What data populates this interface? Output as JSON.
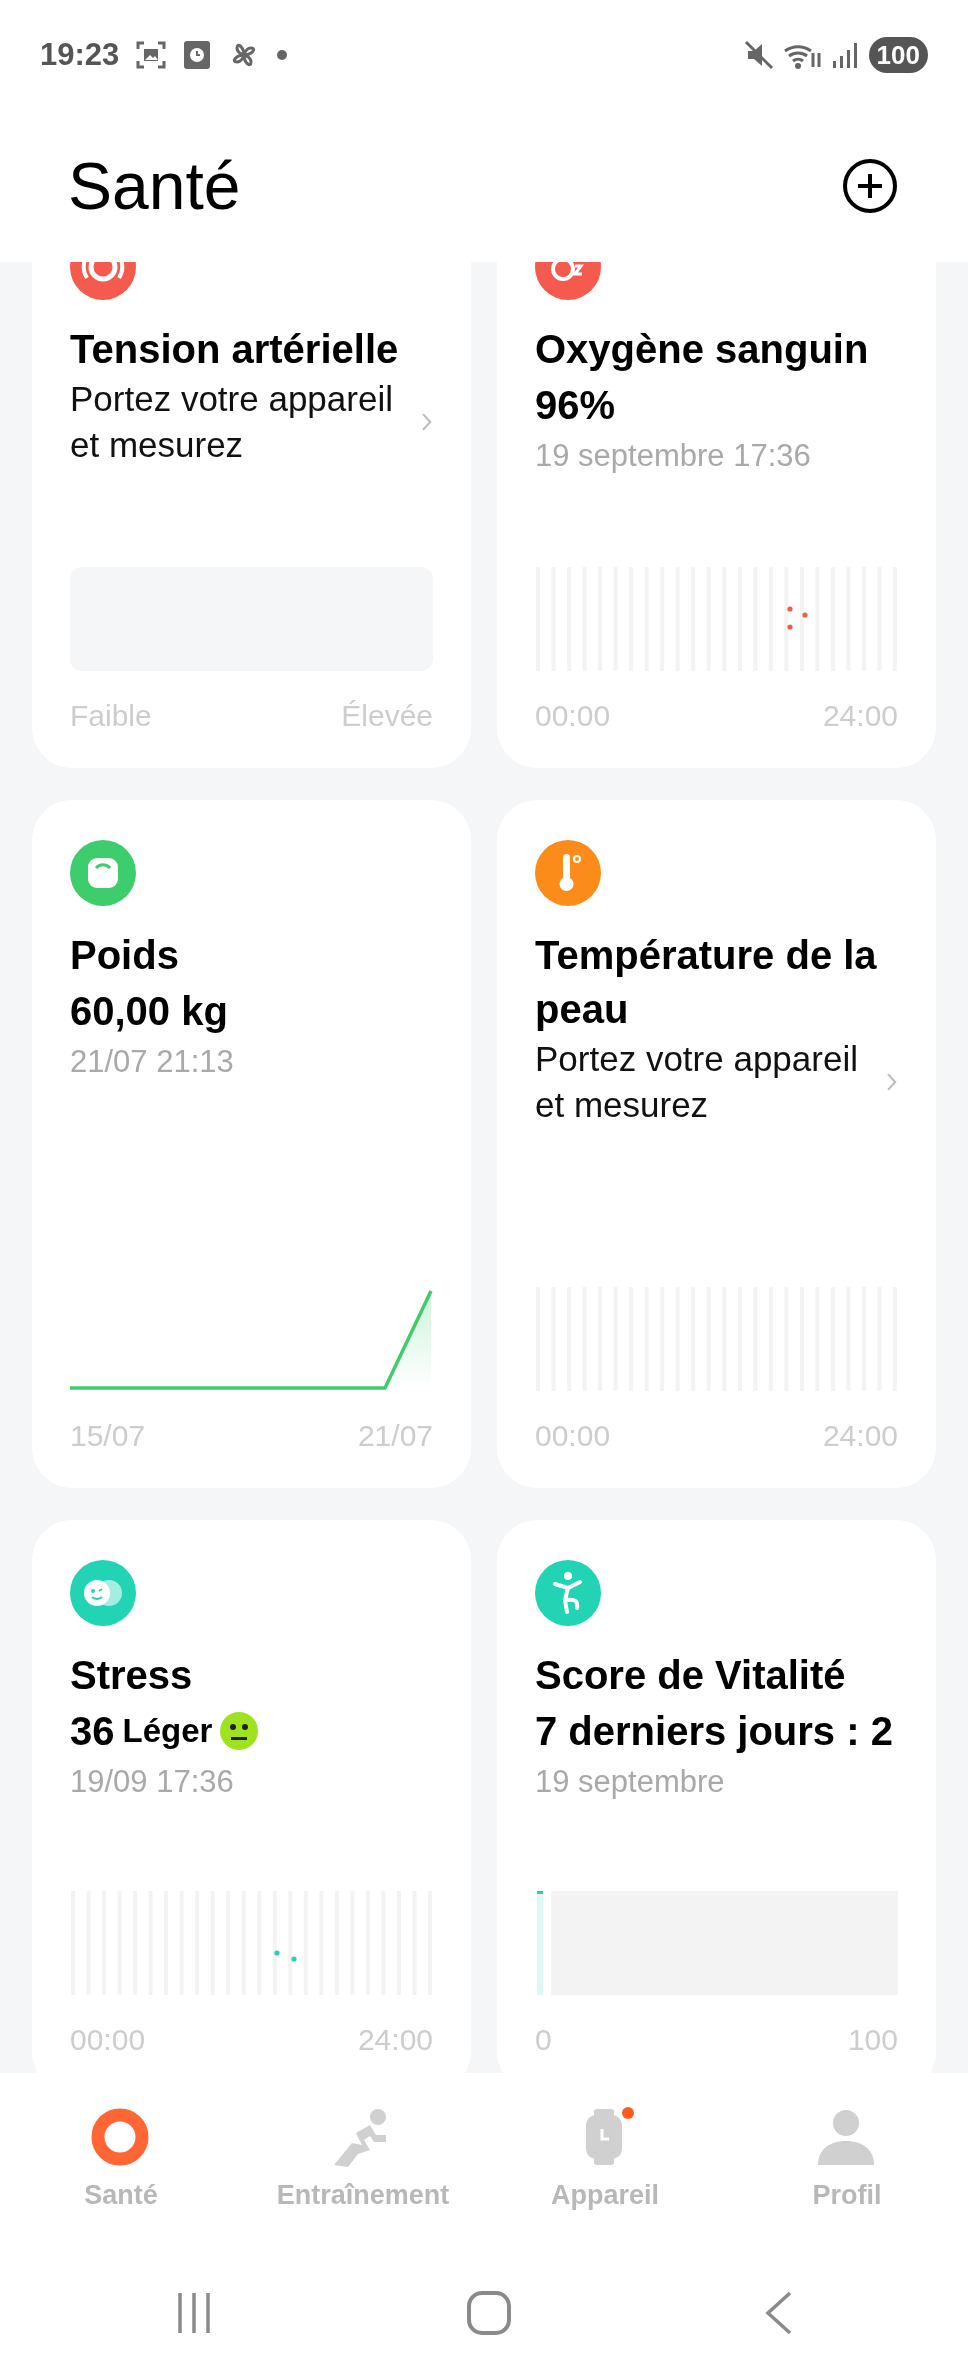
{
  "status_bar": {
    "time": "19:23",
    "battery": "100"
  },
  "header": {
    "title": "Santé"
  },
  "cards": [
    {
      "kind": "prompt",
      "color": "#f55a4e",
      "title": "Tension artérielle",
      "subtitle": "Portez votre appareil et mesurez",
      "chart": {
        "kind": "range"
      },
      "axis": [
        "Faible",
        "Élevée"
      ]
    },
    {
      "kind": "reading",
      "color": "#f55a4e",
      "title": "Oxygène sanguin",
      "value": "96%",
      "date": "19 septembre 17:36",
      "chart": {
        "kind": "dots"
      },
      "axis": [
        "00:00",
        "24:00"
      ]
    },
    {
      "kind": "reading",
      "color": "#3dcd6c",
      "title": "Poids",
      "value": "60,00 kg",
      "date": "21/07 21:13",
      "chart": {
        "kind": "line"
      },
      "axis": [
        "15/07",
        "21/07"
      ]
    },
    {
      "kind": "prompt",
      "color": "#fb8c1a",
      "title": "Température de la peau",
      "subtitle": "Portez votre appareil et mesurez",
      "chart": {
        "kind": "empty"
      },
      "axis": [
        "00:00",
        "24:00"
      ]
    },
    {
      "kind": "reading",
      "color": "#22d3b4",
      "title": "Stress",
      "value": "36",
      "qualifier": "Léger",
      "date": "19/09 17:36",
      "chart": {
        "kind": "dots"
      },
      "axis": [
        "00:00",
        "24:00"
      ]
    },
    {
      "kind": "reading",
      "color": "#22d3b4",
      "title": "Score de Vitalité",
      "value": "7 derniers jours : 2",
      "date": "19 septembre",
      "chart": {
        "kind": "bar"
      },
      "axis": [
        "0",
        "100"
      ]
    }
  ],
  "tabs": [
    {
      "label": "Santé",
      "selected": true,
      "badge": false
    },
    {
      "label": "Entraînement",
      "selected": false,
      "badge": false
    },
    {
      "label": "Appareil",
      "selected": false,
      "badge": true
    },
    {
      "label": "Profil",
      "selected": false,
      "badge": false
    }
  ]
}
